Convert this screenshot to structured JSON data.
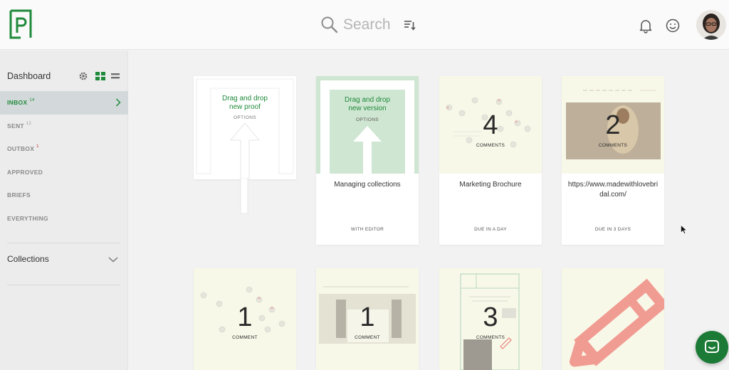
{
  "brand": {
    "logo_letter": "p",
    "accent": "#1f8a3b"
  },
  "header": {
    "search_placeholder": "Search"
  },
  "sidebar": {
    "dashboard_label": "Dashboard",
    "nav": [
      {
        "label": "INBOX",
        "count": "14",
        "active": true
      },
      {
        "label": "SENT",
        "count": "12"
      },
      {
        "label": "OUTBOX",
        "count": "1"
      },
      {
        "label": "APPROVED",
        "count": ""
      },
      {
        "label": "BRIEFS",
        "count": ""
      },
      {
        "label": "EVERYTHING",
        "count": ""
      }
    ],
    "collections_label": "Collections"
  },
  "cards": {
    "new_proof": {
      "line1": "Drag and drop",
      "line2": "new proof",
      "options": "OPTIONS"
    },
    "new_version": {
      "line1": "Drag and drop",
      "line2": "new version",
      "options": "OPTIONS",
      "title": "Managing collections",
      "status": "WITH EDITOR"
    },
    "marketing": {
      "count": "4",
      "count_label": "COMMENTS",
      "title": "Marketing Brochure",
      "status": "DUE IN A DAY"
    },
    "madewithlove": {
      "count": "2",
      "count_label": "COMMENTS",
      "title": "https://www.madewithloveb​ridal.com/",
      "status": "DUE IN 3 DAYS"
    },
    "row2_a": {
      "count": "1",
      "count_label": "COMMENT"
    },
    "row2_b": {
      "count": "1",
      "count_label": "COMMENT"
    },
    "row2_c": {
      "count": "3",
      "count_label": "COMMENTS"
    }
  }
}
